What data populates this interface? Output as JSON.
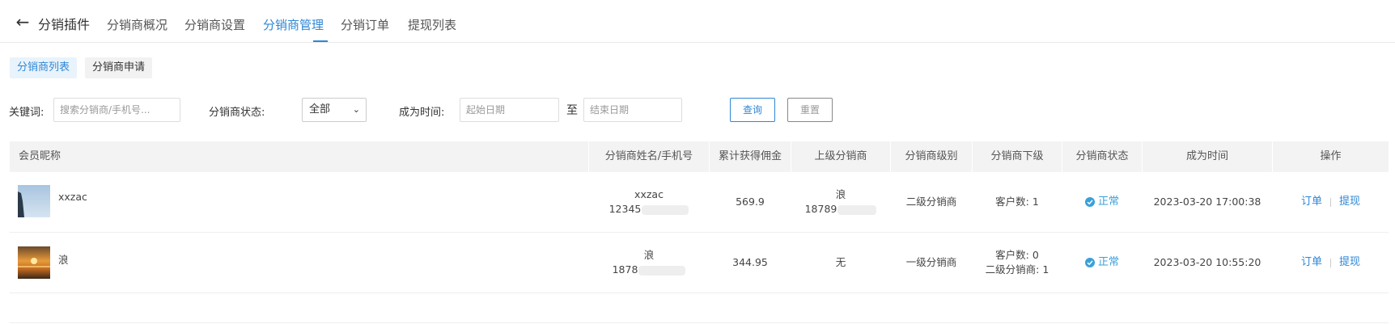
{
  "header": {
    "title": "分销插件",
    "tabs": [
      "分销商概况",
      "分销商设置",
      "分销商管理",
      "分销订单",
      "提现列表"
    ],
    "active_tab": "分销商管理"
  },
  "subtabs": {
    "list": "分销商列表",
    "apply": "分销商申请"
  },
  "filters": {
    "keyword_label": "关键词:",
    "keyword_placeholder": "搜索分销商/手机号...",
    "status_label": "分销商状态:",
    "status_value": "全部",
    "time_label": "成为时间:",
    "start_placeholder": "起始日期",
    "to": "至",
    "end_placeholder": "结束日期",
    "query": "查询",
    "reset": "重置"
  },
  "table": {
    "columns": [
      "会员昵称",
      "分销商姓名/手机号",
      "累计获得佣金",
      "上级分销商",
      "分销商级别",
      "分销商下级",
      "分销商状态",
      "成为时间",
      "操作"
    ],
    "rows": [
      {
        "nickname": "xxzac",
        "name": "xxzac",
        "phone_visible": "12345",
        "commission": "569.9",
        "parent_name": "浪",
        "parent_phone_visible": "18789",
        "level": "二级分销商",
        "sub_1": "客户数: 1",
        "sub_2": "",
        "status": "正常",
        "time": "2023-03-20 17:00:38",
        "op_order": "订单",
        "op_withdraw": "提现"
      },
      {
        "nickname": "浪",
        "name": "浪",
        "phone_visible": "1878",
        "commission": "344.95",
        "parent_name": "无",
        "parent_phone_visible": "",
        "level": "一级分销商",
        "sub_1": "客户数: 0",
        "sub_2": "二级分销商: 1",
        "status": "正常",
        "time": "2023-03-20 10:55:20",
        "op_order": "订单",
        "op_withdraw": "提现"
      }
    ]
  },
  "colors": {
    "accent": "#2f87d6",
    "status": "#3aa0d8",
    "header_bg": "#f3f3f3"
  },
  "icons": {
    "back": "arrow-left-icon",
    "status": "check-circle-icon",
    "select": "chevron-down-icon"
  }
}
